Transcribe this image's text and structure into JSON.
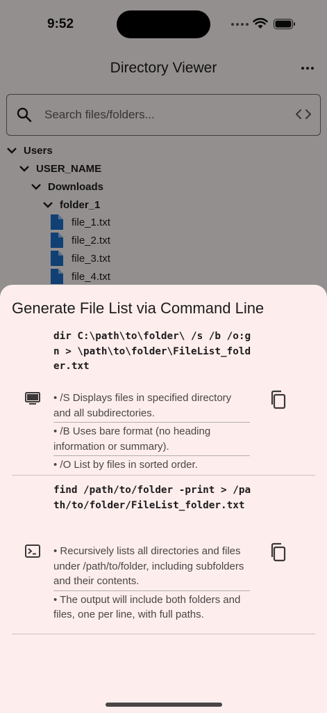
{
  "status_bar": {
    "time": "9:52"
  },
  "app_bar": {
    "title": "Directory Viewer"
  },
  "search": {
    "placeholder": "Search files/folders..."
  },
  "tree": {
    "folders": [
      "Users",
      "USER_NAME",
      "Downloads",
      "folder_1"
    ],
    "files": [
      "file_1.txt",
      "file_2.txt",
      "file_3.txt",
      "file_4.txt"
    ]
  },
  "sheet": {
    "title": "Generate File List via Command Line",
    "windows": {
      "command": "dir C:\\path\\to\\folder\\ /s /b /o:gn > \\path\\to\\folder\\FileList_folder.txt",
      "notes": [
        "• /S Displays files in specified directory and all subdirectories.",
        "• /B Uses bare format (no heading information or summary).",
        "• /O List by files in sorted order."
      ]
    },
    "unix": {
      "command": "find /path/to/folder -print > /path/to/folder/FileList_folder.txt",
      "notes": [
        "• Recursively lists all directories and files under /path/to/folder, including subfolders and their contents.",
        "• The output will include both folders and files, one per line, with full paths."
      ]
    }
  },
  "icons": {
    "windows": "desktop-monitor-icon",
    "unix": "terminal-icon",
    "copy": "copy-icon",
    "file": "file-document-icon"
  },
  "colors": {
    "file_icon": "#1e6fc9",
    "scrim": "rgba(0,0,0,0.42)",
    "sheet_bg": "#fdeeed"
  }
}
